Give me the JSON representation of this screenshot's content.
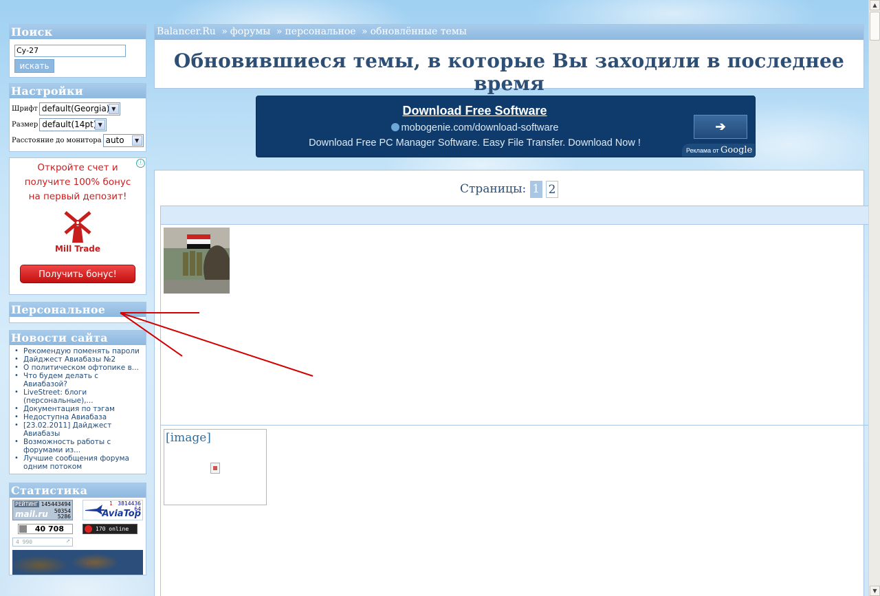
{
  "sidebar": {
    "search": {
      "title": "Поиск",
      "query": "Су-27",
      "button": "искать"
    },
    "settings": {
      "title": "Настройки",
      "font_label": "Шрифт",
      "font_value": "default(Georgia)",
      "size_label": "Размер",
      "size_value": "default(14pt)",
      "distance_label": "Расстояние до монитора",
      "distance_value": "auto"
    },
    "ad": {
      "line1": "Откройте счет и",
      "line2": "получите 100% бонус",
      "line3": "на первый депозит!",
      "brand": "Mill Trade",
      "button": "Получить бонус!",
      "info_icon": "ⓘ"
    },
    "personal": {
      "title": "Персональное"
    },
    "news": {
      "title": "Новости сайта",
      "items": [
        "Рекомендую поменять пароли",
        "Дайджест Авиабазы №2",
        "О политическом офтопике в...",
        "Что будем делать с Авиабазой?",
        "LiveStreet: блоги (персональные),...",
        "Документация по тэгам",
        "Недоступна Авиабаза",
        "[23.02.2011] Дайджест Авиабазы",
        "Возможность работы с форумами из...",
        "Лучшие сообщения форума одним потоком"
      ]
    },
    "stats": {
      "title": "Статистика",
      "mail_label": "РЕЙТИНГ",
      "mail_v1": "145443494",
      "mail_logo": "mail.ru",
      "mail_v2": "50354",
      "mail_v3": "5286",
      "avia_n1": "1",
      "avia_n2": "3814436",
      "avia_n3": "64",
      "avia_logo": "AviaTop",
      "li_value": "40 708",
      "online": "170 online",
      "small_value": "4 990"
    }
  },
  "header": {
    "breadcrumb": [
      "Balancer.Ru",
      "форумы",
      "персональное",
      "обновлённые темы"
    ],
    "separator": "»",
    "title": "Обновившиеся темы, в которые Вы заходили в последнее время"
  },
  "banner": {
    "title": "Download Free Software",
    "url": "mobogenie.com/download-software",
    "description": "Download Free PC Manager Software. Easy File Transfer. Download Now !",
    "button": "➔",
    "ads_by": "Реклама от",
    "google": "Google"
  },
  "content": {
    "pages_label": "Страницы:",
    "pages": [
      "1",
      "2"
    ],
    "image_label": "[image]"
  },
  "colors": {
    "accent": "#8db8df",
    "title": "#2d4f76",
    "banner_bg": "#0e3b6b",
    "annotation": "#d40000"
  }
}
